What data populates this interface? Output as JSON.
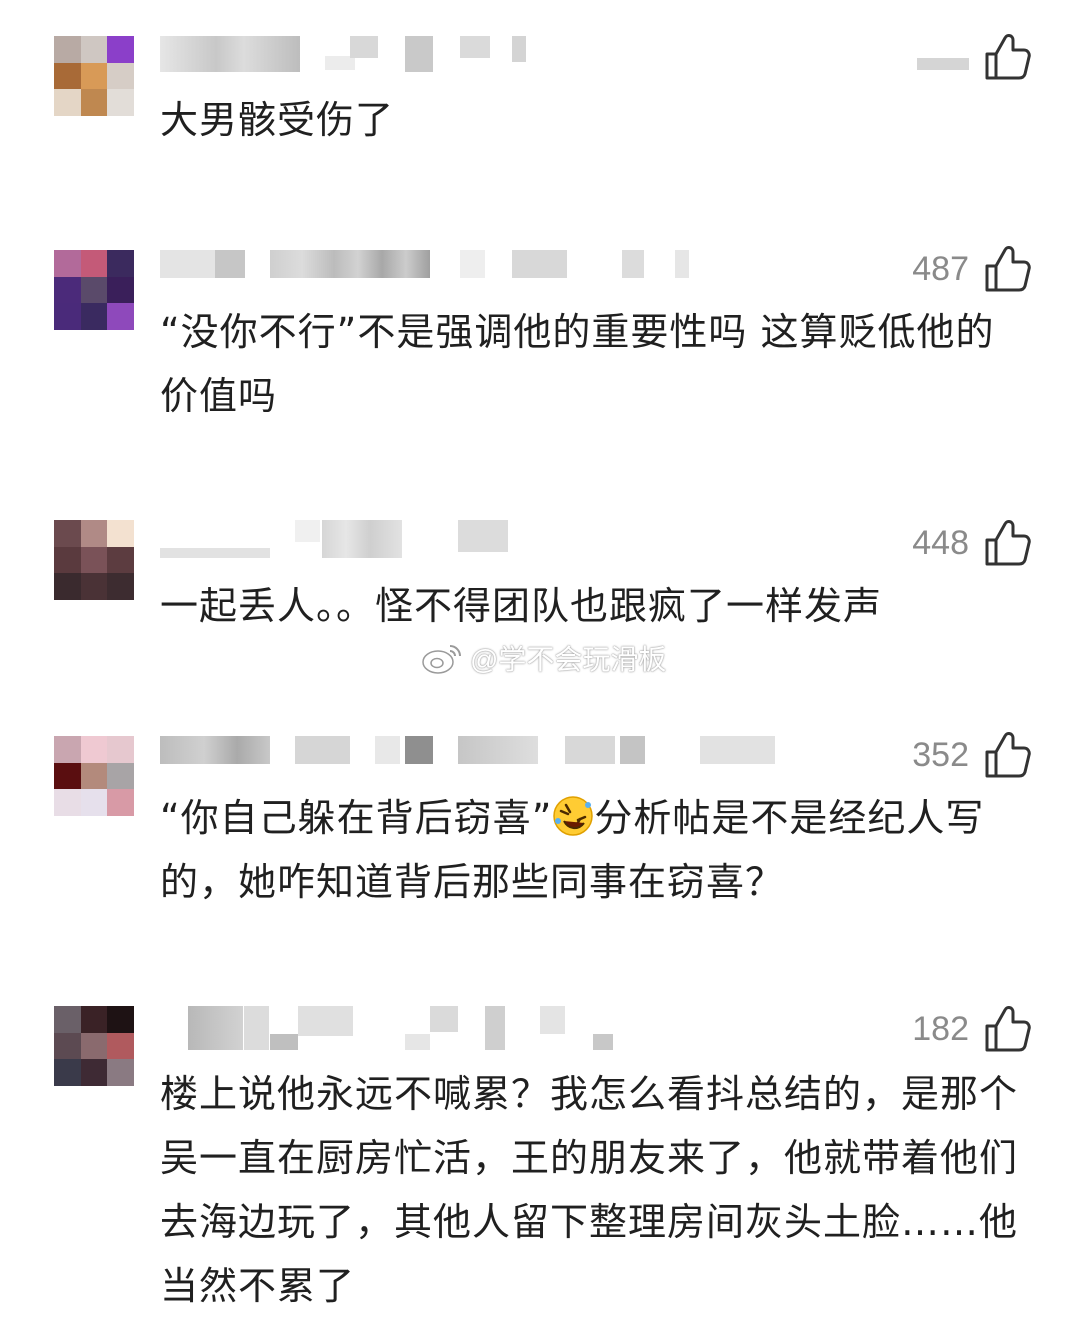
{
  "comments": [
    {
      "text": "大男骸受伤了",
      "like_count": "",
      "avatar_colors": [
        "#b8aaa4",
        "#cfc7c2",
        "#8b3fc9",
        "#a86a37",
        "#d89a57",
        "#d6cdc6",
        "#e4d6c6",
        "#bf8850",
        "#e2ddd8"
      ]
    },
    {
      "text": "“没你不行”不是强调他的重要性吗 这算贬低他的价值吗",
      "like_count": "487",
      "avatar_colors": [
        "#b26a9a",
        "#c45a78",
        "#3b2a5e",
        "#4b2a7a",
        "#5a4a6a",
        "#3a1f5a",
        "#4a2a7a",
        "#3a2a60",
        "#8e49bb"
      ]
    },
    {
      "text": "一起丢人。。怪不得团队也跟疯了一样发声",
      "like_count": "448",
      "avatar_colors": [
        "#6b4a4e",
        "#b08a86",
        "#f3e1d0",
        "#5a3a3e",
        "#7a5258",
        "#5c3c40",
        "#3a2a2e",
        "#4a3236",
        "#3d2c30"
      ]
    },
    {
      "text_before_emoji": "“你自己躲在背后窃喜”",
      "emoji": "rolling-on-floor-laughing-emoji",
      "text_after_emoji": "分析帖是不是经纪人写的，她咋知道背后那些同事在窃喜？",
      "like_count": "352",
      "avatar_colors": [
        "#c9a6b0",
        "#efc9d2",
        "#e6c8cf",
        "#5a0e10",
        "#b38a7c",
        "#a8a4a6",
        "#e8dde6",
        "#e6e0ec",
        "#d89aa6"
      ]
    },
    {
      "text": "楼上说他永远不喊累？我怎么看抖总结的，是那个吴一直在厨房忙活，王的朋友来了，他就带着他们去海边玩了，其他人留下整理房间灰头土脸……他当然不累了",
      "like_count": "182",
      "avatar_colors": [
        "#6a6068",
        "#3a2226",
        "#1e1214",
        "#5c4a52",
        "#8a6a6e",
        "#b05a5e",
        "#3a3a4a",
        "#3e2a34",
        "#8a7a82"
      ]
    }
  ],
  "watermark": {
    "text": "@学不会玩滑板",
    "icon": "weibo-logo-icon"
  },
  "icons": {
    "like": "thumbs-up-icon"
  }
}
